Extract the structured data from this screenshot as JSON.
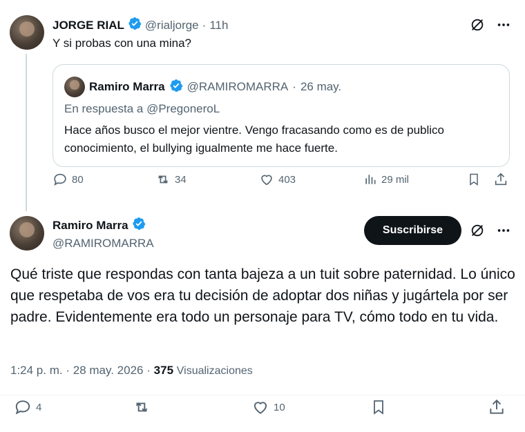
{
  "reply_tweet": {
    "author_name": "JORGE RIAL",
    "author_handle": "@rialjorge",
    "separator": "·",
    "time": "11h",
    "text": "Y si probas con una mina?",
    "quote": {
      "author_name": "Ramiro Marra",
      "author_handle": "@RAMIROMARRA",
      "separator": "·",
      "date": "26 may.",
      "in_reply_to": "En respuesta a @PregoneroL",
      "text": "Hace años busco el mejor vientre. Vengo fracasando como es de publico conocimiento, el bullying igualmente me hace fuerte."
    },
    "stats": {
      "replies": "80",
      "retweets": "34",
      "likes": "403",
      "views": "29 mil"
    }
  },
  "main_tweet": {
    "author_name": "Ramiro Marra",
    "author_handle": "@RAMIROMARRA",
    "subscribe_label": "Suscribirse",
    "text": "Qué triste que respondas con tanta bajeza a un tuit sobre paternidad. Lo único que respetaba de vos era tu decisión de adoptar dos niñas y jugártela por ser padre. Evidentemente era todo un personaje para TV, cómo todo en tu vida.",
    "time": "1:24 p. m.",
    "separator": "·",
    "date": "28 may. 2026",
    "separator2": "·",
    "views_count": "375",
    "views_label": "Visualizaciones",
    "stats": {
      "replies": "4",
      "likes": "10"
    }
  },
  "colors": {
    "verified_blue": "#1d9bf0",
    "text_primary": "#0f1419",
    "text_secondary": "#536471",
    "border": "#cfd9de"
  },
  "icons": [
    "verified-badge-icon",
    "grok-icon",
    "more-icon",
    "reply-icon",
    "retweet-icon",
    "like-icon",
    "views-icon",
    "bookmark-icon",
    "share-icon"
  ]
}
